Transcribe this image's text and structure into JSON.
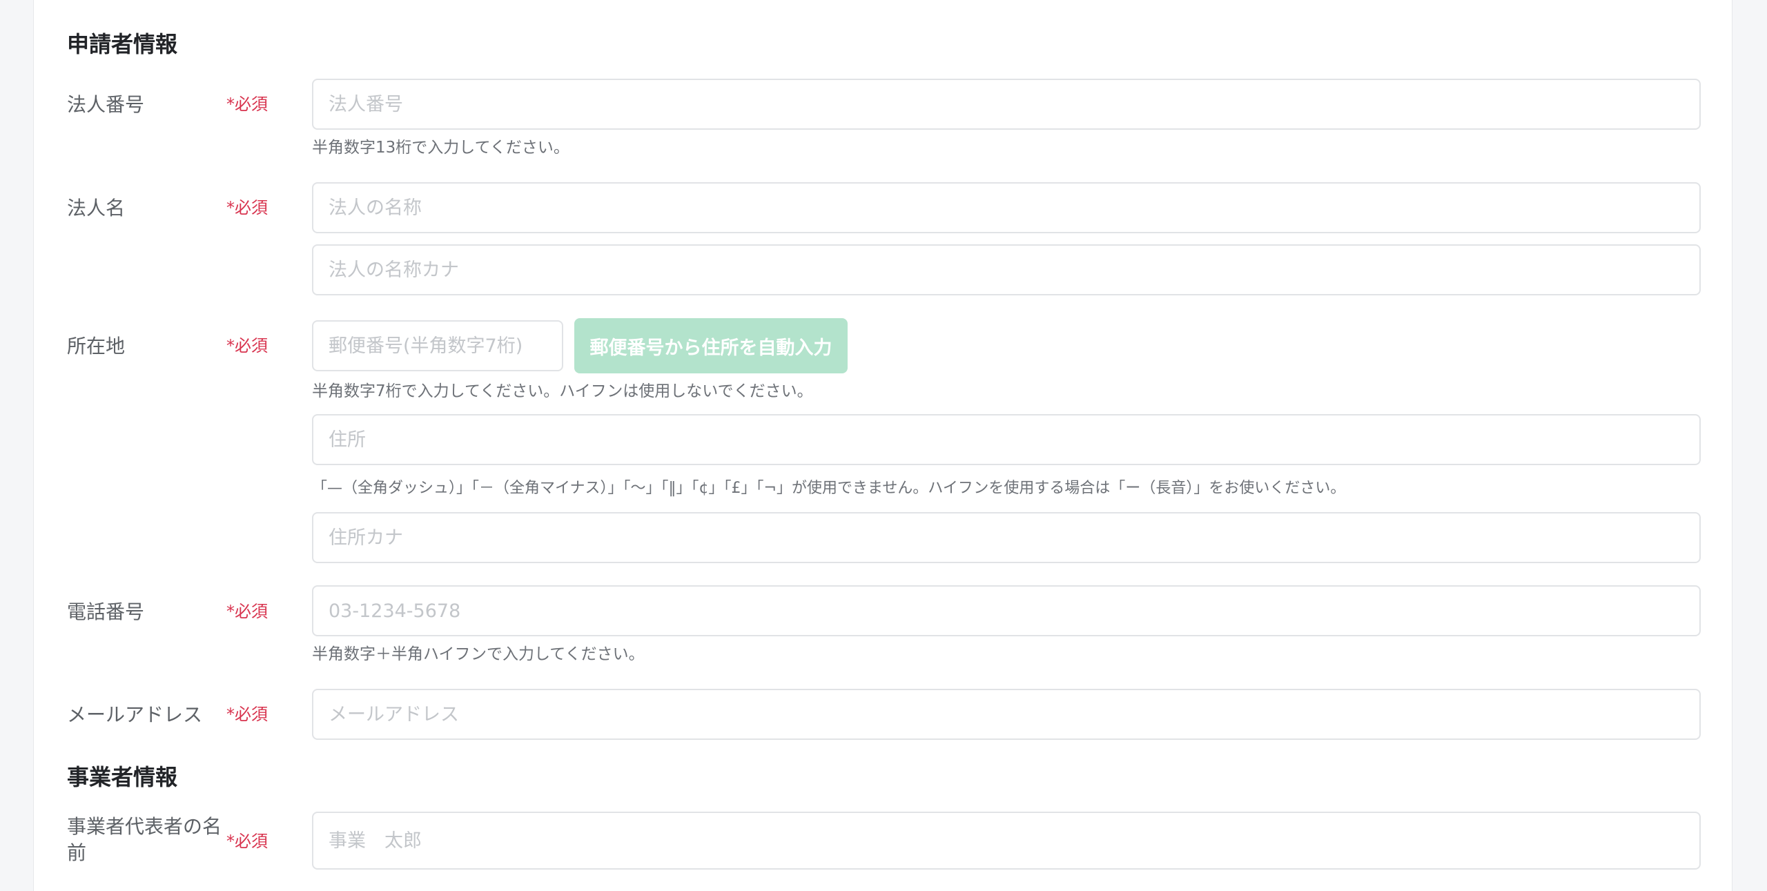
{
  "applicant_section": {
    "title": "申請者情報",
    "required_mark": "*必須",
    "corporate_number": {
      "label": "法人番号",
      "placeholder": "法人番号",
      "hint": "半角数字13桁で入力してください。"
    },
    "corporate_name": {
      "label": "法人名",
      "placeholder_name": "法人の名称",
      "placeholder_kana": "法人の名称カナ"
    },
    "address": {
      "label": "所在地",
      "postal_placeholder": "郵便番号(半角数字7桁)",
      "auto_fill_button": "郵便番号から住所を自動入力",
      "postal_hint": "半角数字7桁で入力してください。ハイフンは使用しないでください。",
      "address_placeholder": "住所",
      "address_hint": "「—（全角ダッシュ）」「－（全角マイナス）」「〜」「‖」「¢」「£」「¬」が使用できません。ハイフンを使用する場合は「ー（長音）」をお使いください。",
      "address_kana_placeholder": "住所カナ"
    },
    "phone": {
      "label": "電話番号",
      "placeholder": "03-1234-5678",
      "hint": "半角数字＋半角ハイフンで入力してください。"
    },
    "email": {
      "label": "メールアドレス",
      "placeholder": "メールアドレス"
    }
  },
  "business_section": {
    "title": "事業者情報",
    "representative": {
      "label": "事業者代表者の名前",
      "placeholder": "事業　太郎"
    }
  }
}
